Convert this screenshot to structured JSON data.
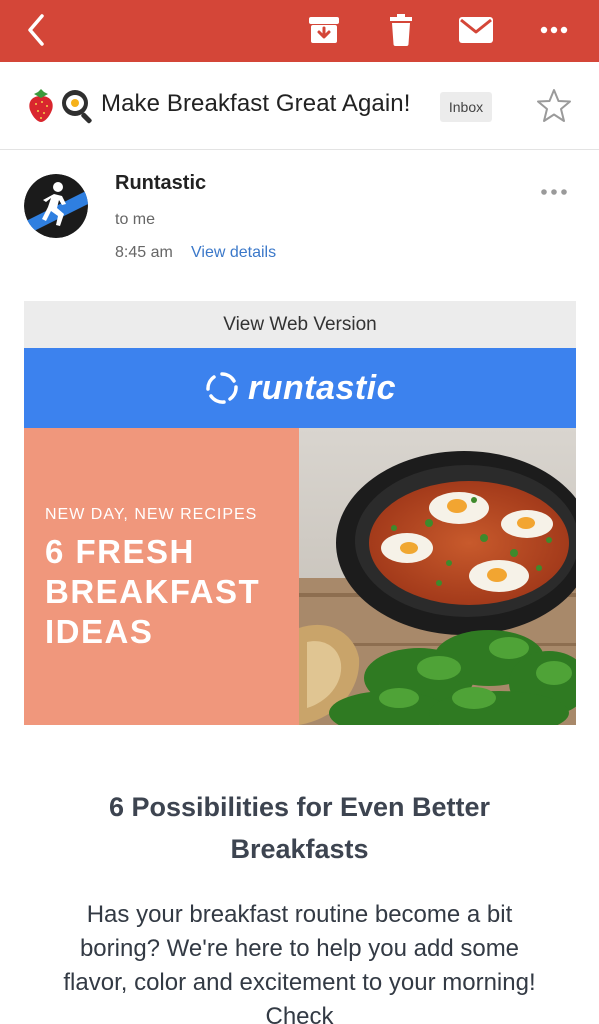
{
  "toolbar": {
    "back_icon": "chevron-left-icon",
    "archive_icon": "archive-icon",
    "delete_icon": "trash-icon",
    "mail_icon": "envelope-icon",
    "more_icon": "more-dots-icon",
    "color": "#d44638"
  },
  "subject": {
    "emoji_1": "strawberry",
    "emoji_2": "frying-pan-egg",
    "text": "Make Breakfast Great Again!",
    "label_badge": "Inbox",
    "starred": false
  },
  "sender": {
    "name": "Runtastic",
    "recipient": "to me",
    "time": "8:45 am",
    "details_link": "View details"
  },
  "email_body": {
    "web_version": "View Web Version",
    "brand": "runtastic",
    "brand_color": "#3c82ee",
    "hero_kicker": "NEW DAY, NEW RECIPES",
    "hero_headline_lines": [
      "6 FRESH",
      "BREAKFAST",
      "IDEAS"
    ],
    "hero_color": "#f0977c",
    "heading": "6 Possibilities for Even Better Breakfasts",
    "paragraph": "Has your breakfast routine become a bit boring? We're here to help you add some flavor, color and excitement to your morning! Check"
  }
}
